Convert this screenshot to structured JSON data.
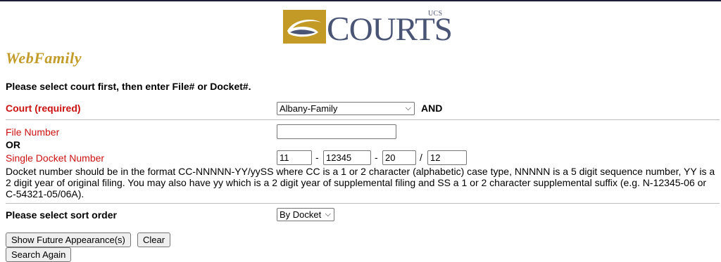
{
  "logo": {
    "word": "COURTS",
    "superscript": "UCS"
  },
  "app_title": "WebFamily",
  "instruction": "Please select court first, then enter File# or Docket#.",
  "court": {
    "label": "Court (required)",
    "selected": "Albany-Family",
    "and_label": "AND"
  },
  "file_number": {
    "label": "File Number",
    "value": ""
  },
  "or_label": "OR",
  "docket": {
    "label": "Single Docket Number",
    "case_type": "11",
    "sequence": "12345",
    "year": "20",
    "suffix": "12",
    "sep1": "-",
    "sep2": "-",
    "sep3": "/",
    "help_text": "Docket number should be in the format CC-NNNNN-YY/yySS where CC is a 1 or 2 character (alphabetic) case type, NNNNN is a 5 digit sequence number, YY is a 2 digit year of original filing. You may also have yy which is a 2 digit year of supplemental filing and SS a 1 or 2 character supplemental suffix (e.g. N-12345-06 or C-54321-05/06A)."
  },
  "sort": {
    "label": "Please select sort order",
    "selected": "By Docket"
  },
  "buttons": {
    "show_future": "Show Future Appearance(s)",
    "clear": "Clear",
    "search_again": "Search Again"
  },
  "icons": {
    "dropdown": "chevron-down-icon",
    "logo_emblem": "ucs-courts-emblem"
  },
  "colors": {
    "title_gold": "#c39b28",
    "required_red": "#cc1111",
    "logo_slate": "#4a5576"
  }
}
